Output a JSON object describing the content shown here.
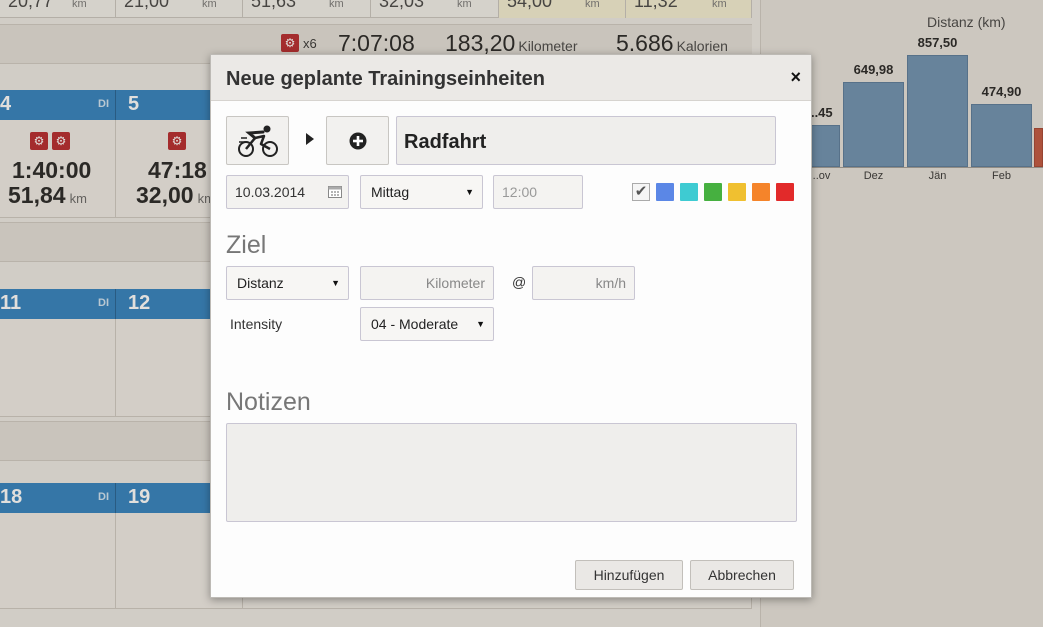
{
  "background": {
    "top_row": [
      {
        "value": "20,77",
        "unit": "km"
      },
      {
        "value": "21,00",
        "unit": "km"
      },
      {
        "value": "51,63",
        "unit": "km"
      },
      {
        "value": "32,03",
        "unit": "km"
      },
      {
        "value": "54,00",
        "unit": "km"
      },
      {
        "value": "11,32",
        "unit": "km"
      }
    ],
    "summary": {
      "count": "x6",
      "duration": "7:07:08",
      "distance": "183,20",
      "distance_unit": "Kilometer",
      "calories": "5.686",
      "calories_unit": "Kalorien"
    },
    "weeks": [
      {
        "days": [
          {
            "num": "4",
            "dow": "DI"
          },
          {
            "num": "5",
            "dow": ""
          }
        ]
      },
      {
        "days": [
          {
            "num": "11",
            "dow": "DI"
          },
          {
            "num": "12",
            "dow": ""
          }
        ]
      },
      {
        "days": [
          {
            "num": "18",
            "dow": "DI"
          },
          {
            "num": "19",
            "dow": ""
          }
        ]
      }
    ],
    "day4": {
      "time": "1:40:00",
      "km": "51,84",
      "unit": "km"
    },
    "day5": {
      "time": "47:18",
      "km": "32,00",
      "unit": "km"
    }
  },
  "chart": {
    "title": "Distanz (km)",
    "bars": [
      {
        "label": "...45",
        "cat": "...ov"
      },
      {
        "label": "649,98",
        "cat": "Dez"
      },
      {
        "label": "857,50",
        "cat": "Jän"
      },
      {
        "label": "474,90",
        "cat": "Feb"
      }
    ]
  },
  "dialog": {
    "title": "Neue geplante Trainingseinheiten",
    "close_label": "×",
    "activity_name": "Radfahrt",
    "date_value": "10.03.2014",
    "time_of_day": "Mittag",
    "time_placeholder": "12:00",
    "colors": [
      "#5b87e6",
      "#3ecbd2",
      "#46b040",
      "#f0c030",
      "#f5842a",
      "#e22a2a"
    ],
    "goal_section": "Ziel",
    "goal_type": "Distanz",
    "distance_placeholder": "Kilometer",
    "at_symbol": "@",
    "speed_placeholder": "km/h",
    "intensity_label": "Intensity",
    "intensity_value": "04 - Moderate",
    "notes_section": "Notizen",
    "add_button": "Hinzufügen",
    "cancel_button": "Abbrechen"
  }
}
